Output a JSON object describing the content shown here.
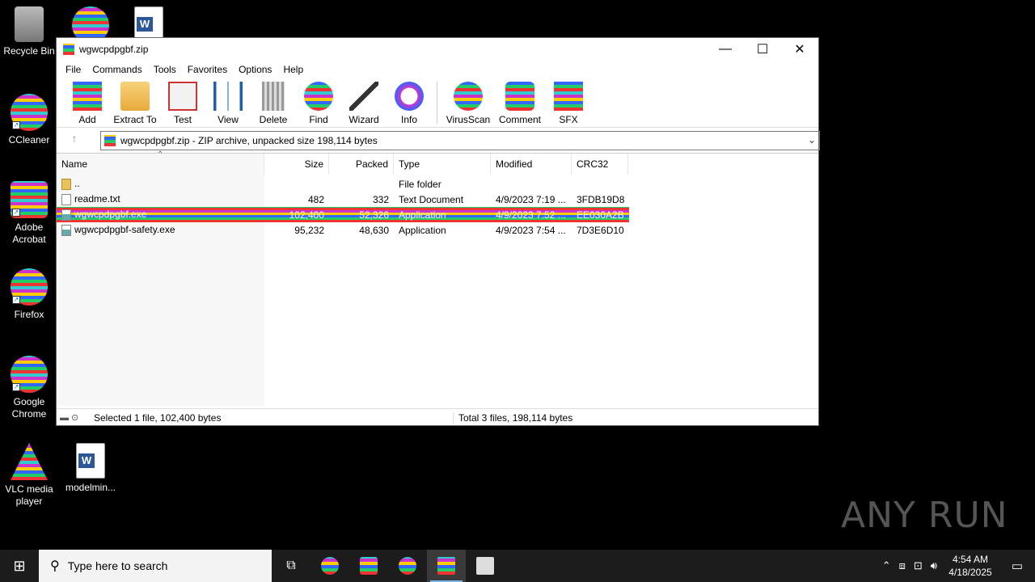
{
  "desktop": {
    "icons": [
      {
        "label": "Recycle Bin",
        "icon": "recycle-bin-icon"
      },
      {
        "label": "CCleaner",
        "icon": "ccleaner-icon"
      },
      {
        "label": "Adobe Acrobat",
        "icon": "acrobat-icon"
      },
      {
        "label": "Firefox",
        "icon": "firefox-icon"
      },
      {
        "label": "Google Chrome",
        "icon": "chrome-icon"
      },
      {
        "label": "VLC media player",
        "icon": "vlc-icon"
      },
      {
        "label": "modelmin...",
        "icon": "word-document-icon"
      }
    ]
  },
  "window": {
    "title": "wgwcpdpgbf.zip",
    "controls": {
      "minimize": "—",
      "maximize": "☐",
      "close": "✕"
    },
    "menu": [
      "File",
      "Commands",
      "Tools",
      "Favorites",
      "Options",
      "Help"
    ],
    "toolbar": [
      {
        "label": "Add",
        "icon": "add-archive-icon"
      },
      {
        "label": "Extract To",
        "icon": "extract-folder-icon"
      },
      {
        "label": "Test",
        "icon": "test-clipboard-icon"
      },
      {
        "label": "View",
        "icon": "view-book-icon"
      },
      {
        "label": "Delete",
        "icon": "delete-bin-icon"
      },
      {
        "label": "Find",
        "icon": "find-magnifier-icon"
      },
      {
        "label": "Wizard",
        "icon": "wizard-wand-icon"
      },
      {
        "label": "Info",
        "icon": "info-icon"
      },
      {
        "label": "VirusScan",
        "icon": "virusscan-icon"
      },
      {
        "label": "Comment",
        "icon": "comment-icon"
      },
      {
        "label": "SFX",
        "icon": "sfx-icon"
      }
    ],
    "address": "wgwcpdpgbf.zip - ZIP archive, unpacked size 198,114 bytes",
    "columns": [
      "Name",
      "Size",
      "Packed",
      "Type",
      "Modified",
      "CRC32"
    ],
    "rows": [
      {
        "name": "..",
        "size": "",
        "packed": "",
        "type": "File folder",
        "modified": "",
        "crc": "",
        "kind": "folder"
      },
      {
        "name": "readme.txt",
        "size": "482",
        "packed": "332",
        "type": "Text Document",
        "modified": "4/9/2023 7:19 ...",
        "crc": "3FDB19D8",
        "kind": "txt"
      },
      {
        "name": "wgwcpdpgbf.exe",
        "size": "102,400",
        "packed": "52,326",
        "type": "Application",
        "modified": "4/9/2023 7:52 ...",
        "crc": "EE030A2B",
        "kind": "exe",
        "selected": true
      },
      {
        "name": "wgwcpdpgbf-safety.exe",
        "size": "95,232",
        "packed": "48,630",
        "type": "Application",
        "modified": "4/9/2023 7:54 ...",
        "crc": "7D3E6D10",
        "kind": "exe"
      }
    ],
    "status_left": "Selected 1 file, 102,400 bytes",
    "status_right": "Total 3 files, 198,114 bytes"
  },
  "taskbar": {
    "search_placeholder": "Type here to search",
    "time": "4:54 AM",
    "date": "4/18/2025"
  },
  "watermark": "ANY RUN"
}
